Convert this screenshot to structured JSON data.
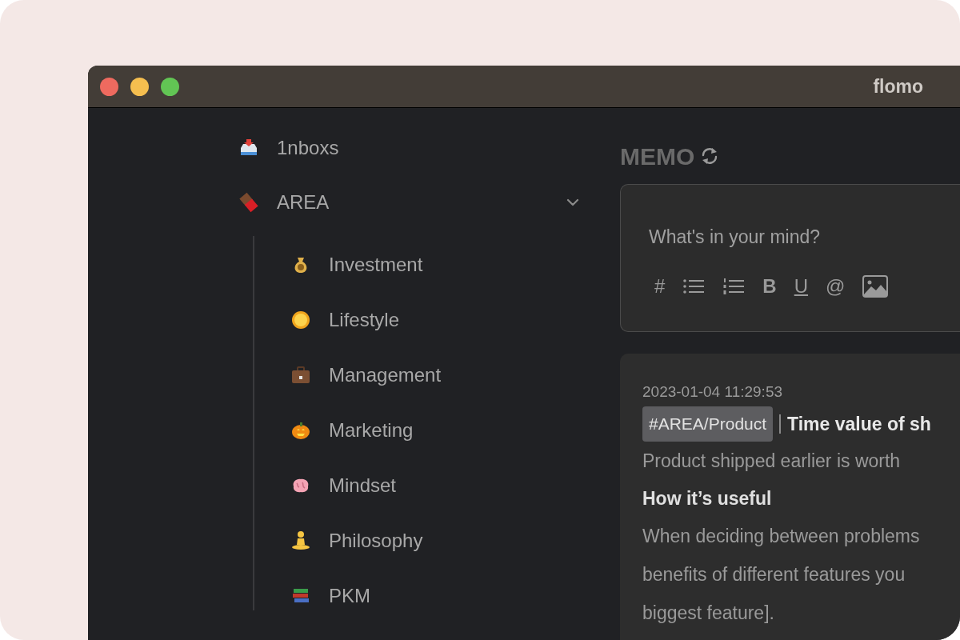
{
  "window": {
    "title": "flomo"
  },
  "sidebar": {
    "items": [
      {
        "label": "1nboxs"
      },
      {
        "label": "AREA",
        "expanded": true,
        "children": [
          {
            "label": "Investment"
          },
          {
            "label": "Lifestyle"
          },
          {
            "label": "Management"
          },
          {
            "label": "Marketing"
          },
          {
            "label": "Mindset"
          },
          {
            "label": "Philosophy"
          },
          {
            "label": "PKM"
          }
        ]
      }
    ]
  },
  "main": {
    "heading": "MEMO",
    "editor": {
      "placeholder": "What's in your mind?",
      "toolbar": [
        {
          "kind": "char",
          "label": "#"
        },
        {
          "kind": "bullets"
        },
        {
          "kind": "numbers"
        },
        {
          "kind": "bold",
          "label": "B"
        },
        {
          "kind": "underline",
          "label": "U"
        },
        {
          "kind": "char",
          "label": "@"
        },
        {
          "kind": "image"
        }
      ]
    },
    "memo": {
      "timestamp": "2023-01-04 11:29:53",
      "tag": "#AREA/Product",
      "title": "Time value of sh",
      "lines": [
        {
          "kind": "text",
          "text": "Product shipped earlier is worth"
        },
        {
          "kind": "heading",
          "text": "How it’s useful"
        },
        {
          "kind": "text",
          "text": "When deciding between problems"
        },
        {
          "kind": "text",
          "text": "benefits of different features you"
        },
        {
          "kind": "text",
          "text": "biggest feature]."
        }
      ]
    }
  }
}
